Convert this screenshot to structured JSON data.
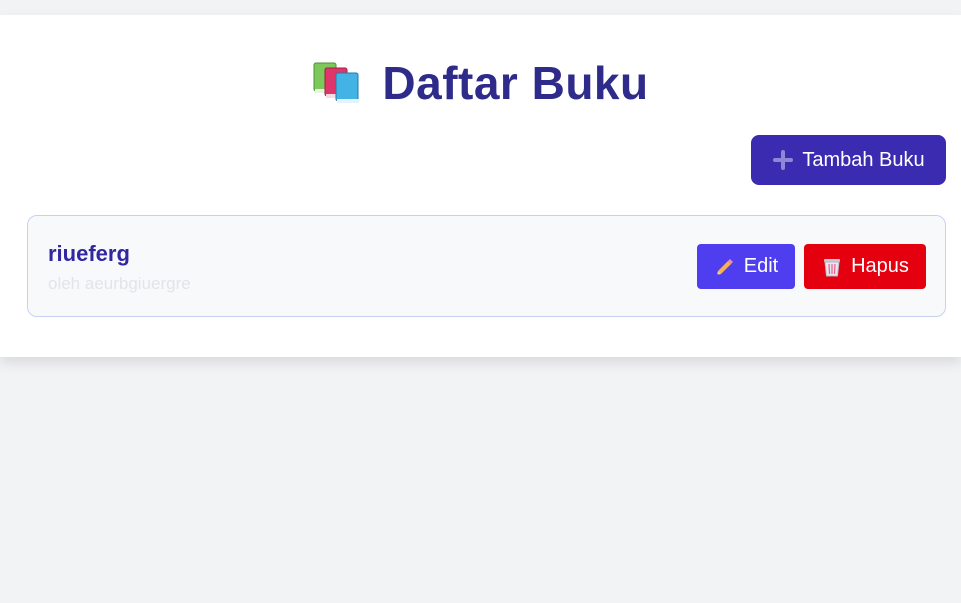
{
  "header": {
    "title": "Daftar Buku",
    "title_icon": "books-icon"
  },
  "toolbar": {
    "add_label": "Tambah Buku",
    "add_icon": "plus-icon"
  },
  "books": [
    {
      "title": "riueferg",
      "author_line": "oleh aeurbgiuergre",
      "edit_label": "Edit",
      "edit_icon": "pencil-icon",
      "delete_label": "Hapus",
      "delete_icon": "trash-icon"
    }
  ],
  "colors": {
    "page_background": "#f2f3f5",
    "title": "#2e2b8a",
    "add_button": "#3b2bb0",
    "edit_button": "#4f3ef0",
    "delete_button": "#e50010",
    "book_title": "#3227a0"
  }
}
